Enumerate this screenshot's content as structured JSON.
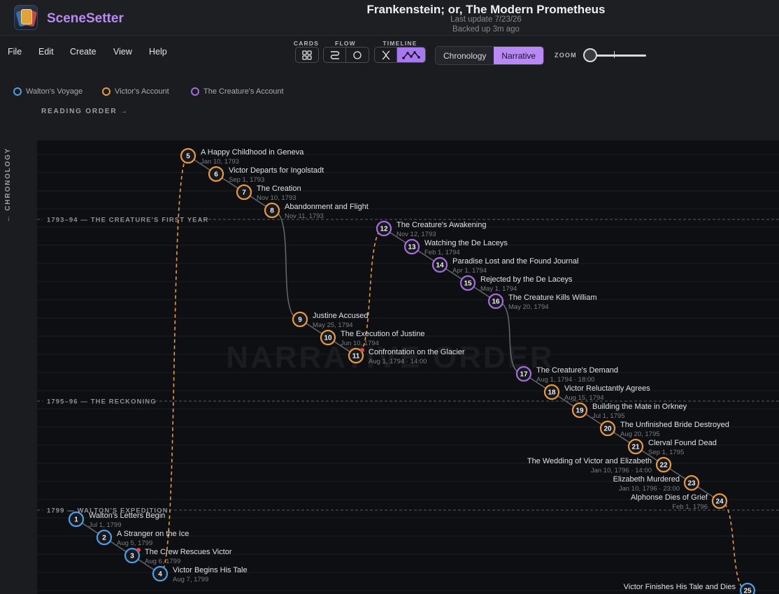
{
  "app": {
    "name": "SceneSetter",
    "icon": "card-stack-icon"
  },
  "document": {
    "title": "Frankenstein; or, The Modern Prometheus",
    "last_update": "Last update 7/23/26",
    "backup": "Backed up 3m ago"
  },
  "menu": [
    "File",
    "Edit",
    "Create",
    "View",
    "Help"
  ],
  "toolbar": {
    "cards_label": "CARDS",
    "flow_label": "FLOW",
    "timeline_label": "TIMELINE",
    "cards_buttons": [
      "grid-icon"
    ],
    "flow_buttons": [
      "flow-path-icon",
      "circle-icon"
    ],
    "timeline_buttons": [
      "crossing-lines-icon",
      "wave-line-icon"
    ],
    "timeline_active": "wave-line-icon",
    "view_options": [
      "Chronology",
      "Narrative"
    ],
    "view_active": "Narrative",
    "zoom_label": "ZOOM",
    "zoom_level": 0
  },
  "legend": [
    {
      "label": "Walton's Voyage",
      "color": "#4aa0e6"
    },
    {
      "label": "Victor's Account",
      "color": "#e79b3c"
    },
    {
      "label": "The Creature's Account",
      "color": "#a66cde"
    }
  ],
  "axes": {
    "reading_order": "READING ORDER →",
    "chronology": "← CHRONOLOGY"
  },
  "watermark": "NARRATIVE ORDER",
  "eras": [
    {
      "label": "1793–94 — THE CREATURE'S FIRST YEAR"
    },
    {
      "label": "1795–96 — THE RECKONING"
    },
    {
      "label": "1799 — WALTON'S EXPEDITION"
    }
  ],
  "scenes": [
    {
      "n": "1",
      "title": "Walton's Letters Begin",
      "date": "Jul 1, 1799",
      "thread": "walton",
      "marker": false,
      "label_side": "right"
    },
    {
      "n": "2",
      "title": "A Stranger on the Ice",
      "date": "Aug 5, 1799",
      "thread": "walton",
      "marker": false,
      "label_side": "right"
    },
    {
      "n": "3",
      "title": "The Crew Rescues Victor",
      "date": "Aug 6, 1799",
      "thread": "walton",
      "marker": true,
      "label_side": "right"
    },
    {
      "n": "4",
      "title": "Victor Begins His Tale",
      "date": "Aug 7, 1799",
      "thread": "walton",
      "marker": false,
      "label_side": "right"
    },
    {
      "n": "5",
      "title": "A Happy Childhood in Geneva",
      "date": "Jan 10, 1793",
      "thread": "victor",
      "marker": false,
      "label_side": "right"
    },
    {
      "n": "6",
      "title": "Victor Departs for Ingolstadt",
      "date": "Sep 1, 1793",
      "thread": "victor",
      "marker": false,
      "label_side": "right"
    },
    {
      "n": "7",
      "title": "The Creation",
      "date": "Nov 10, 1793",
      "thread": "victor",
      "marker": false,
      "label_side": "right"
    },
    {
      "n": "8",
      "title": "Abandonment and Flight",
      "date": "Nov 11, 1793",
      "thread": "victor",
      "marker": false,
      "label_side": "right"
    },
    {
      "n": "9",
      "title": "Justine Accused",
      "date": "May 25, 1794",
      "thread": "victor",
      "marker": false,
      "label_side": "right"
    },
    {
      "n": "10",
      "title": "The Execution of Justine",
      "date": "Jun 10, 1794",
      "thread": "victor",
      "marker": false,
      "label_side": "right"
    },
    {
      "n": "11",
      "title": "Confrontation on the Glacier",
      "date": "Aug 1, 1794 · 14:00",
      "thread": "victor",
      "marker": true,
      "label_side": "right"
    },
    {
      "n": "12",
      "title": "The Creature's Awakening",
      "date": "Nov 12, 1793",
      "thread": "creature",
      "marker": false,
      "label_side": "right"
    },
    {
      "n": "13",
      "title": "Watching the De Laceys",
      "date": "Feb 1, 1794",
      "thread": "creature",
      "marker": false,
      "label_side": "right"
    },
    {
      "n": "14",
      "title": "Paradise Lost and the Found Journal",
      "date": "Apr 1, 1794",
      "thread": "creature",
      "marker": false,
      "label_side": "right"
    },
    {
      "n": "15",
      "title": "Rejected by the De Laceys",
      "date": "May 1, 1794",
      "thread": "creature",
      "marker": false,
      "label_side": "right"
    },
    {
      "n": "16",
      "title": "The Creature Kills William",
      "date": "May 20, 1794",
      "thread": "creature",
      "marker": false,
      "label_side": "right"
    },
    {
      "n": "17",
      "title": "The Creature's Demand",
      "date": "Aug 1, 1794 · 18:00",
      "thread": "creature",
      "marker": false,
      "label_side": "right"
    },
    {
      "n": "18",
      "title": "Victor Reluctantly Agrees",
      "date": "Aug 15, 1794",
      "thread": "victor",
      "marker": false,
      "label_side": "right"
    },
    {
      "n": "19",
      "title": "Building the Mate in Orkney",
      "date": "Jul 1, 1795",
      "thread": "victor",
      "marker": false,
      "label_side": "right"
    },
    {
      "n": "20",
      "title": "The Unfinished Bride Destroyed",
      "date": "Aug 20, 1795",
      "thread": "victor",
      "marker": false,
      "label_side": "right"
    },
    {
      "n": "21",
      "title": "Clerval Found Dead",
      "date": "Sep 1, 1795",
      "thread": "victor",
      "marker": false,
      "label_side": "right"
    },
    {
      "n": "22",
      "title": "The Wedding of Victor and Elizabeth",
      "date": "Jan 10, 1796 · 14:00",
      "thread": "victor",
      "marker": false,
      "label_side": "left"
    },
    {
      "n": "23",
      "title": "Elizabeth Murdered",
      "date": "Jan 10, 1796 · 23:00",
      "thread": "victor",
      "marker": false,
      "label_side": "left"
    },
    {
      "n": "24",
      "title": "Alphonse Dies of Grief",
      "date": "Feb 1, 1796",
      "thread": "victor",
      "marker": false,
      "label_side": "left"
    },
    {
      "n": "25",
      "title": "Victor Finishes His Tale and Dies",
      "date": "",
      "thread": "walton",
      "marker": false,
      "label_side": "left"
    }
  ],
  "thread_colors": {
    "walton": "#4aa0e6",
    "victor": "#e79b3c",
    "creature": "#a66cde"
  },
  "connector_color": "#e79b3c",
  "marker_color": "#e5484d"
}
